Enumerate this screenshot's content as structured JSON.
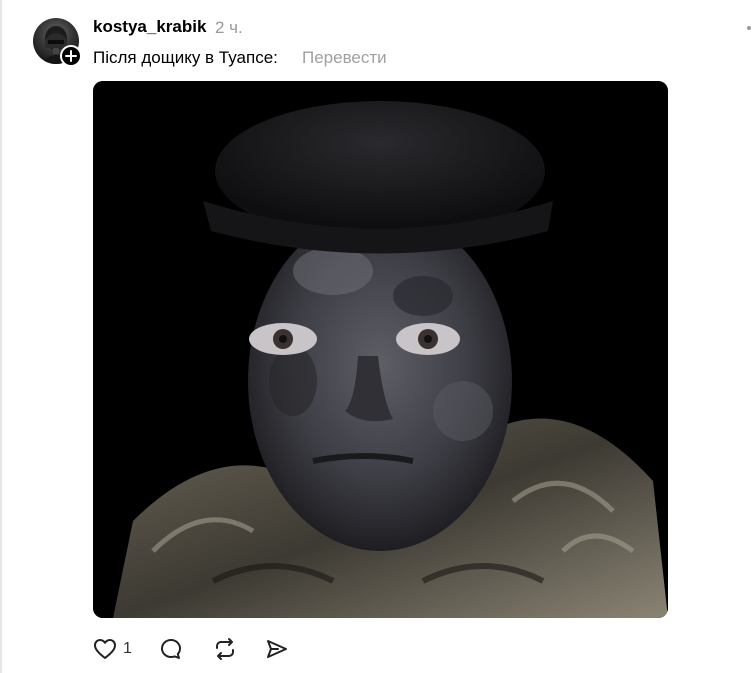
{
  "post": {
    "username": "kostya_krabik",
    "timestamp": "2 ч.",
    "caption": "Після дощику в Туапсе:",
    "translate_label": "Перевести",
    "image_description_icon": "photo",
    "actions": {
      "like_count": "1"
    }
  },
  "icons": {
    "like": "heart-icon",
    "comment": "comment-icon",
    "repost": "repost-icon",
    "share": "share-icon",
    "follow": "plus-icon",
    "more": "more-dots-icon"
  },
  "colors": {
    "text": "#000000",
    "muted": "#999999",
    "translate": "#a0a0a0",
    "image_bg": "#000000"
  }
}
